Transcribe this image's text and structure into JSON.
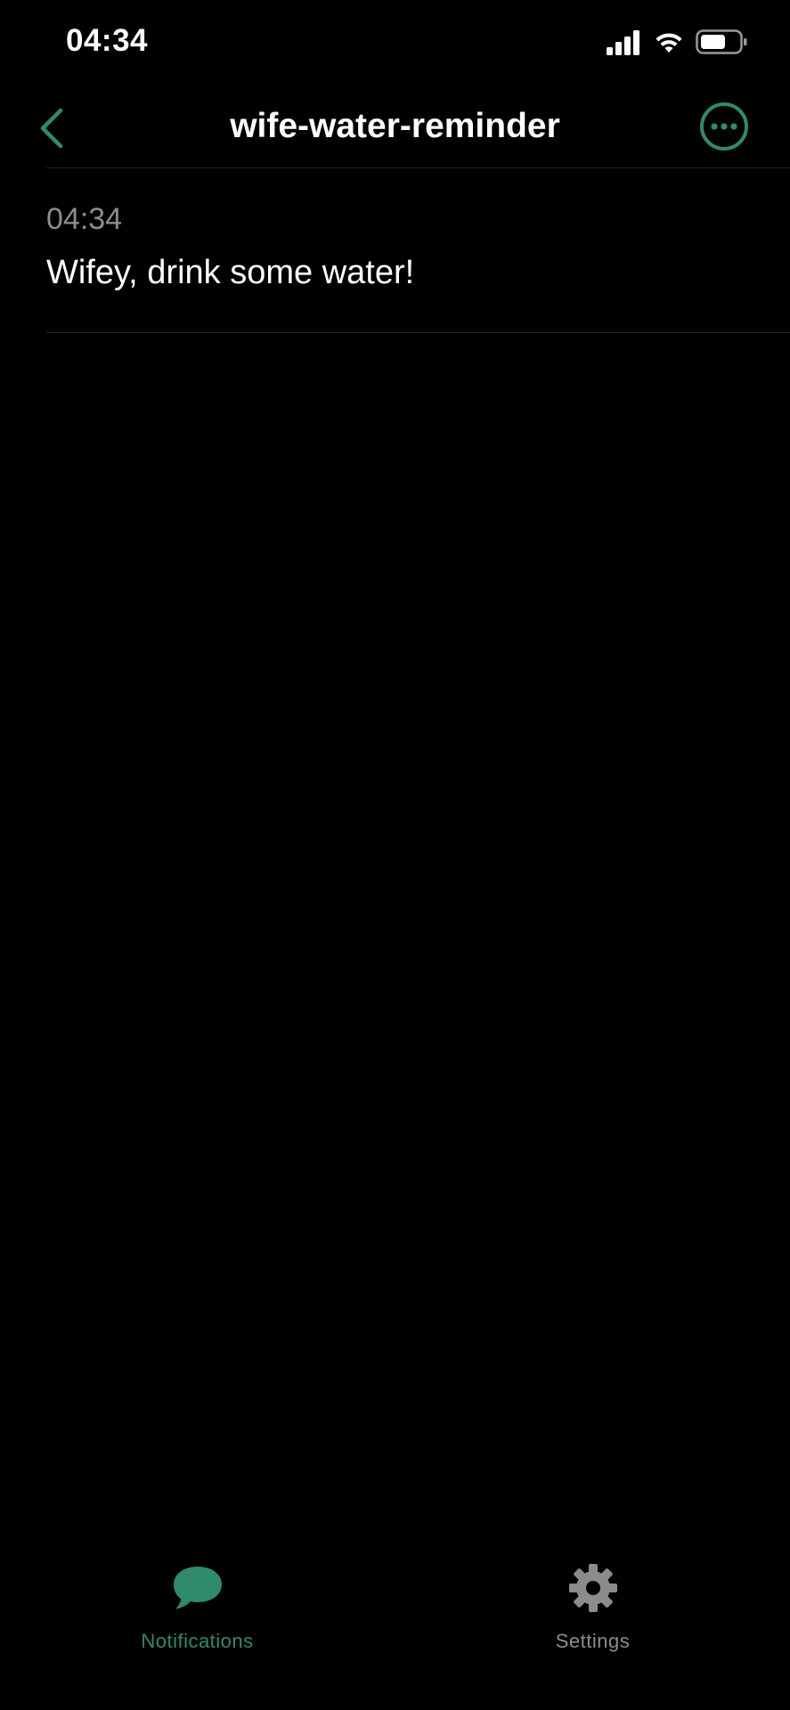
{
  "status_bar": {
    "time": "04:34"
  },
  "nav": {
    "title": "wife-water-reminder",
    "back_icon": "chevron-left-icon",
    "more_icon": "ellipsis-circle-icon"
  },
  "messages": [
    {
      "time": "04:34",
      "text": "Wifey, drink some water!"
    }
  ],
  "tabs": [
    {
      "label": "Notifications",
      "icon": "chat-bubble-icon",
      "active": true
    },
    {
      "label": "Settings",
      "icon": "gear-icon",
      "active": false
    }
  ],
  "colors": {
    "background": "#000000",
    "accent": "#2f8a6e",
    "inactive": "#8c8c8c",
    "divider": "#262626"
  }
}
